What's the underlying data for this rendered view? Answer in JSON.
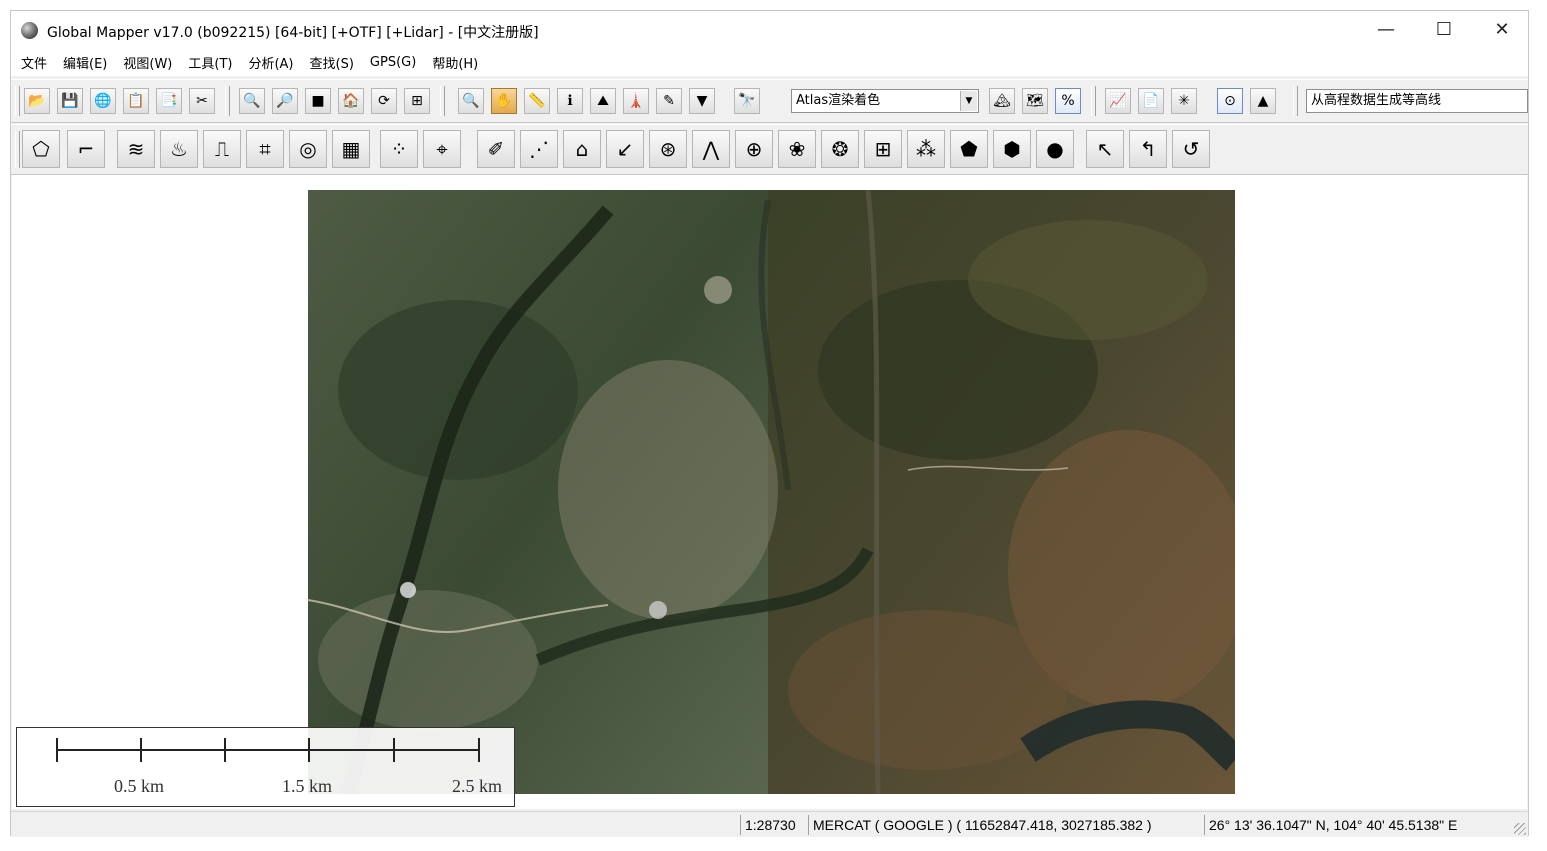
{
  "window": {
    "title": "Global Mapper v17.0 (b092215) [64-bit] [+OTF] [+Lidar] - [中文注册版]",
    "minimize_glyph": "—",
    "maximize_glyph": "☐",
    "close_glyph": "✕"
  },
  "menu": {
    "items": [
      {
        "label": "文件"
      },
      {
        "label": "编辑(E)"
      },
      {
        "label": "视图(W)"
      },
      {
        "label": "工具(T)"
      },
      {
        "label": "分析(A)"
      },
      {
        "label": "查找(S)"
      },
      {
        "label": "GPS(G)"
      },
      {
        "label": "帮助(H)"
      }
    ]
  },
  "toolbar": {
    "shader_select": "Atlas渲染着色",
    "tool_select": "从高程数据生成等高线"
  },
  "scale_bar": {
    "labels": [
      "0.5 km",
      "1.5 km",
      "2.5 km"
    ]
  },
  "status": {
    "scale": "1:28730",
    "projection": "MERCAT ( GOOGLE ) ( 11652847.418, 3027185.382 )",
    "geo_coords": "26° 13' 36.1047\" N, 104° 40' 45.5138\" E"
  },
  "colors": {
    "window_bg": "#f0f0f0",
    "map_bg": "#ffffff",
    "pressed_button": "#e4a94a"
  }
}
